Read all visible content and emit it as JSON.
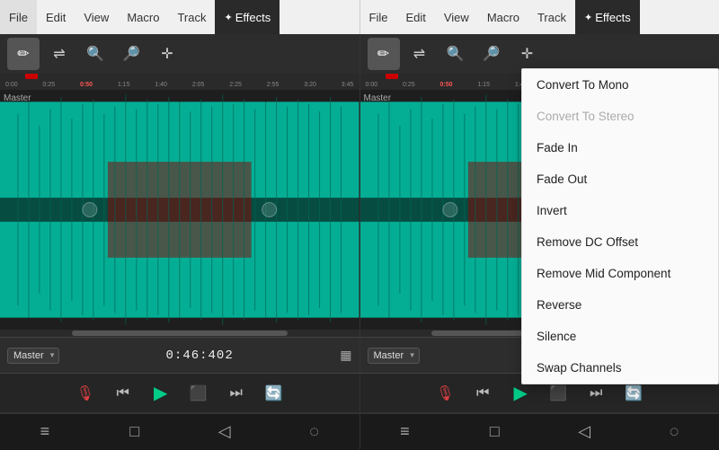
{
  "menuBar": {
    "leftPanel": {
      "items": [
        {
          "label": "File",
          "active": false
        },
        {
          "label": "Edit",
          "active": false
        },
        {
          "label": "View",
          "active": false
        },
        {
          "label": "Macro",
          "active": false
        },
        {
          "label": "Track",
          "active": false
        },
        {
          "label": "Effects",
          "active": true,
          "icon": "✦"
        }
      ]
    },
    "rightPanel": {
      "items": [
        {
          "label": "File",
          "active": false
        },
        {
          "label": "Edit",
          "active": false
        },
        {
          "label": "View",
          "active": false
        },
        {
          "label": "Macro",
          "active": false
        },
        {
          "label": "Track",
          "active": false
        },
        {
          "label": "Effects",
          "active": true,
          "icon": "✦"
        }
      ]
    }
  },
  "toolbar": {
    "tools": [
      "✏",
      "⇄",
      "🔍",
      "🔎",
      "✛"
    ]
  },
  "timeline": {
    "labels": [
      "0:00",
      "0:25",
      "0:50",
      "1:15",
      "1:40",
      "2:05",
      "2:25",
      "2:55",
      "3:20",
      "3:45"
    ]
  },
  "waveform": {
    "label": "Master"
  },
  "bottomBar": {
    "trackName": "Master",
    "time": "0:46:402"
  },
  "transport": {
    "buttons": [
      "mic",
      "skip-back",
      "play",
      "stop",
      "skip-forward",
      "loop"
    ]
  },
  "systemBar": {
    "buttons": [
      "menu",
      "square",
      "triangle-left",
      "person"
    ]
  },
  "dropdown": {
    "items": [
      {
        "label": "Convert To Mono",
        "disabled": false
      },
      {
        "label": "Convert To Stereo",
        "disabled": true
      },
      {
        "label": "Fade In",
        "disabled": false
      },
      {
        "label": "Fade Out",
        "disabled": false
      },
      {
        "label": "Invert",
        "disabled": false
      },
      {
        "label": "Remove DC Offset",
        "disabled": false
      },
      {
        "label": "Remove Mid Component",
        "disabled": false
      },
      {
        "label": "Reverse",
        "disabled": false
      },
      {
        "label": "Silence",
        "disabled": false
      },
      {
        "label": "Swap Channels",
        "disabled": false
      }
    ]
  }
}
